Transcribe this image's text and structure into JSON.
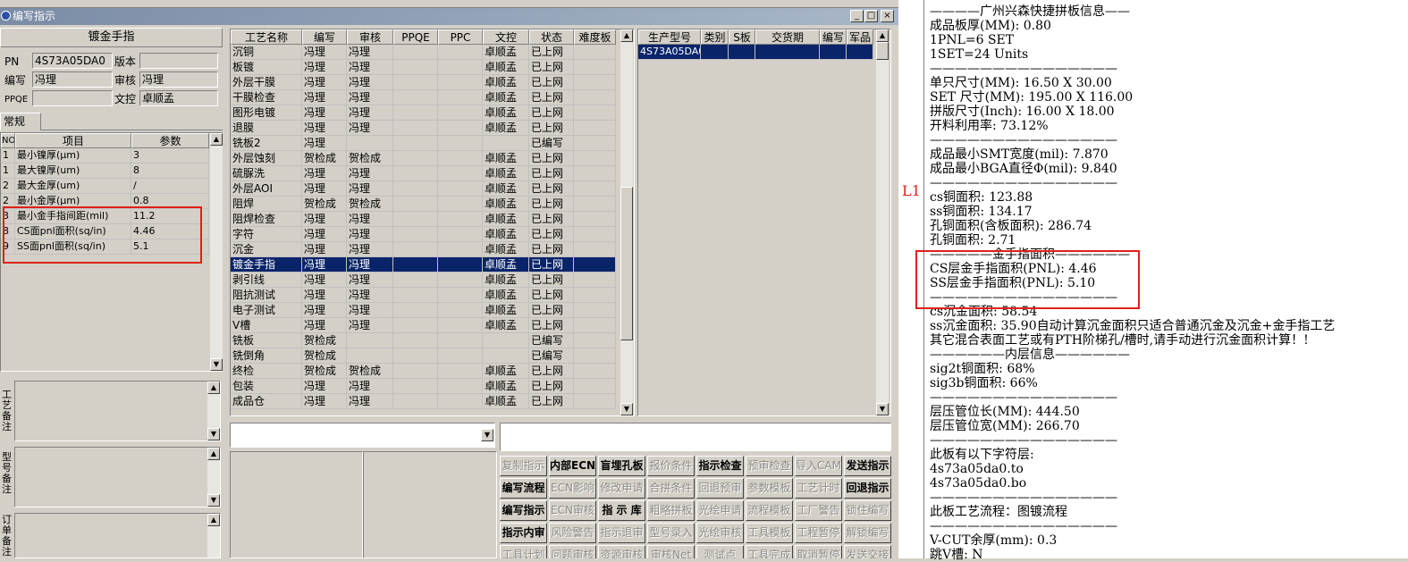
{
  "window": {
    "title": "编写指示",
    "btn_min": "_",
    "btn_max": "□",
    "btn_close": "×"
  },
  "left_panel": {
    "header": "镀金手指",
    "pn_label": "PN",
    "pn_value": "4S73A05DA0",
    "version_label": "版本",
    "version_value": "",
    "writer_label": "编写",
    "writer_value": "冯理",
    "review_label": "审核",
    "review_value": "冯理",
    "ppqe_label": "PPQE",
    "ppqe_value": "",
    "control_label": "文控",
    "control_value": "卓顺孟",
    "tab": "常规",
    "param_columns": [
      "NO",
      "项目",
      "参数"
    ],
    "params": [
      {
        "no": "1",
        "item": "最小镍厚(μm)",
        "value": "3"
      },
      {
        "no": "1",
        "item": "最大镍厚(um)",
        "value": "8"
      },
      {
        "no": "2",
        "item": "最大金厚(um)",
        "value": "/"
      },
      {
        "no": "2",
        "item": "最小金厚(μm)",
        "value": "0.8"
      },
      {
        "no": "3",
        "item": "最小金手指间距(mil)",
        "value": "11.2"
      },
      {
        "no": "8",
        "item": "CS面pnl面积(sq/in)",
        "value": "4.46"
      },
      {
        "no": "9",
        "item": "SS面pnl面积(sq/in)",
        "value": "5.1"
      }
    ],
    "note_labels": [
      "工艺备注",
      "型号备注",
      "订单备注"
    ]
  },
  "process_grid": {
    "columns": [
      "工艺名称",
      "编写",
      "审核",
      "PPQE",
      "PPC",
      "文控",
      "状态",
      "难度板"
    ],
    "rows": [
      [
        "沉铜",
        "冯理",
        "冯理",
        "",
        "",
        "卓顺孟",
        "已上网",
        ""
      ],
      [
        "板镀",
        "冯理",
        "冯理",
        "",
        "",
        "卓顺孟",
        "已上网",
        ""
      ],
      [
        "外层干膜",
        "冯理",
        "冯理",
        "",
        "",
        "卓顺孟",
        "已上网",
        ""
      ],
      [
        "干膜检查",
        "冯理",
        "冯理",
        "",
        "",
        "卓顺孟",
        "已上网",
        ""
      ],
      [
        "图形电镀",
        "冯理",
        "冯理",
        "",
        "",
        "卓顺孟",
        "已上网",
        ""
      ],
      [
        "退膜",
        "冯理",
        "冯理",
        "",
        "",
        "卓顺孟",
        "已上网",
        ""
      ],
      [
        "铣板2",
        "冯理",
        "",
        "",
        "",
        "",
        "已编写",
        ""
      ],
      [
        "外层蚀刻",
        "贺检成",
        "贺检成",
        "",
        "",
        "卓顺孟",
        "已上网",
        ""
      ],
      [
        "硫脲洗",
        "冯理",
        "冯理",
        "",
        "",
        "卓顺孟",
        "已上网",
        ""
      ],
      [
        "外层AOI",
        "冯理",
        "冯理",
        "",
        "",
        "卓顺孟",
        "已上网",
        ""
      ],
      [
        "阻焊",
        "贺检成",
        "贺检成",
        "",
        "",
        "卓顺孟",
        "已上网",
        ""
      ],
      [
        "阻焊检查",
        "冯理",
        "冯理",
        "",
        "",
        "卓顺孟",
        "已上网",
        ""
      ],
      [
        "字符",
        "冯理",
        "冯理",
        "",
        "",
        "卓顺孟",
        "已上网",
        ""
      ],
      [
        "沉金",
        "冯理",
        "冯理",
        "",
        "",
        "卓顺孟",
        "已上网",
        ""
      ],
      [
        "镀金手指",
        "冯理",
        "冯理",
        "",
        "",
        "卓顺孟",
        "已上网",
        ""
      ],
      [
        "剥引线",
        "冯理",
        "冯理",
        "",
        "",
        "卓顺孟",
        "已上网",
        ""
      ],
      [
        "阻抗测试",
        "冯理",
        "冯理",
        "",
        "",
        "卓顺孟",
        "已上网",
        ""
      ],
      [
        "电子测试",
        "冯理",
        "冯理",
        "",
        "",
        "卓顺孟",
        "已上网",
        ""
      ],
      [
        "V槽",
        "冯理",
        "冯理",
        "",
        "",
        "卓顺孟",
        "已上网",
        ""
      ],
      [
        "铣板",
        "贺检成",
        "",
        "",
        "",
        "",
        "已编写",
        ""
      ],
      [
        "铣倒角",
        "贺检成",
        "",
        "",
        "",
        "",
        "已编写",
        ""
      ],
      [
        "终检",
        "贺检成",
        "贺检成",
        "",
        "",
        "卓顺孟",
        "已上网",
        ""
      ],
      [
        "包装",
        "冯理",
        "冯理",
        "",
        "",
        "卓顺孟",
        "已上网",
        ""
      ],
      [
        "成品仓",
        "冯理",
        "冯理",
        "",
        "",
        "卓顺孟",
        "已上网",
        ""
      ]
    ],
    "selected_index": 14
  },
  "model_grid": {
    "columns": [
      "生产型号",
      "类别",
      "S板",
      "交货期",
      "编写",
      "军品"
    ],
    "rows": [
      [
        "4S73A05DA0",
        "",
        "",
        "",
        "",
        ""
      ]
    ]
  },
  "buttons": [
    [
      {
        "t": "复制指示",
        "s": "dis"
      },
      {
        "t": "内部ECN",
        "s": "bold"
      },
      {
        "t": "盲埋孔板",
        "s": "bold"
      },
      {
        "t": "报价条件",
        "s": "dis"
      },
      {
        "t": "指示检查",
        "s": "bold"
      },
      {
        "t": "预审检查",
        "s": "dis"
      },
      {
        "t": "导入CAM",
        "s": "dis"
      },
      {
        "t": "发送指示",
        "s": "bold"
      }
    ],
    [
      {
        "t": "编写流程",
        "s": "bold"
      },
      {
        "t": "ECN影响",
        "s": "dis"
      },
      {
        "t": "修改申请",
        "s": "dis"
      },
      {
        "t": "合拼条件",
        "s": "dis"
      },
      {
        "t": "回退预审",
        "s": "dis"
      },
      {
        "t": "参数模板",
        "s": "dis"
      },
      {
        "t": "工艺计时",
        "s": "dis"
      },
      {
        "t": "回退指示",
        "s": "bold"
      }
    ],
    [
      {
        "t": "编写指示",
        "s": "bold"
      },
      {
        "t": "ECN审核",
        "s": "dis"
      },
      {
        "t": "指 示 库",
        "s": "bold"
      },
      {
        "t": "粗略拼板",
        "s": "dis"
      },
      {
        "t": "光绘申请",
        "s": "dis"
      },
      {
        "t": "流程模板",
        "s": "dis"
      },
      {
        "t": "工厂警告",
        "s": "dis"
      },
      {
        "t": "锁住编写",
        "s": "dis"
      }
    ],
    [
      {
        "t": "指示内审",
        "s": "bold"
      },
      {
        "t": "风险警告",
        "s": "dis"
      },
      {
        "t": "指示退审",
        "s": "dis"
      },
      {
        "t": "型号录入",
        "s": "dis"
      },
      {
        "t": "光绘审核",
        "s": "dis"
      },
      {
        "t": "工具模板",
        "s": "dis"
      },
      {
        "t": "工程暂停",
        "s": "dis"
      },
      {
        "t": "解锁编写",
        "s": "dis"
      }
    ],
    [
      {
        "t": "工具计划",
        "s": "dis"
      },
      {
        "t": "问题审核",
        "s": "dis"
      },
      {
        "t": "资源审核",
        "s": "dis"
      },
      {
        "t": "审核Net",
        "s": "dis"
      },
      {
        "t": "测试点",
        "s": "dis"
      },
      {
        "t": "工具完成",
        "s": "dis"
      },
      {
        "t": "取消暂停",
        "s": "dis"
      },
      {
        "t": "发送交接",
        "s": "dis"
      }
    ]
  ],
  "edge_text": "L1",
  "info_text": [
    "————广州兴森快捷拼板信息——",
    "成品板厚(MM): 0.80",
    "1PNL=6 SET",
    "1SET=24 Units",
    "———————————————",
    "单只尺寸(MM): 16.50 X 30.00",
    "SET 尺寸(MM): 195.00 X 116.00",
    "拼版尺寸(Inch): 16.00 X 18.00",
    "开料利用率: 73.12%",
    "———————————————",
    "成品最小SMT宽度(mil): 7.870",
    "成品最小BGA直径Φ(mil):  9.840",
    "———————————————",
    "cs铜面积: 123.88",
    "ss铜面积: 134.17",
    "孔铜面积(含板面积): 286.74",
    "孔铜面积: 2.71",
    "—————金手指面积——————",
    "CS层金手指面积(PNL): 4.46",
    "SS层金手指面积(PNL): 5.10",
    "———————————————",
    "cs沉金面积: 58.54",
    "ss沉金面积: 35.90自动计算沉金面积只适合普通沉金及沉金+金手指工艺",
    "其它混合表面工艺或有PTH阶梯孔/槽时,请手动进行沉金面积计算！!",
    "——————内层信息——————",
    "sig2t铜面积: 68%",
    "sig3b铜面积: 66%",
    "———————————————",
    "层压管位长(MM): 444.50",
    "层压管位宽(MM): 266.70",
    "———————————————",
    "此板有以下字符层:",
    "4s73a05da0.to",
    "4s73a05da0.bo",
    "———————————————",
    "此板工艺流程：图镀流程",
    "———————————————",
    "V-CUT余厚(mm): 0.3",
    "跳V槽: N"
  ]
}
